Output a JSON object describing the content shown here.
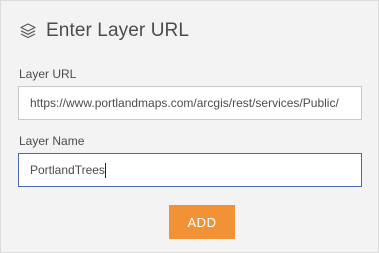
{
  "dialog": {
    "title": "Enter Layer URL",
    "icon": "layers-icon"
  },
  "layer_url": {
    "label": "Layer URL",
    "value": "https://www.portlandmaps.com/arcgis/rest/services/Public/"
  },
  "layer_name": {
    "label": "Layer Name",
    "value": "PortlandTrees"
  },
  "actions": {
    "add_label": "ADD"
  },
  "colors": {
    "accent": "#f09235",
    "focus_border": "#4b6bb0",
    "panel_bg": "#f3f3f3"
  }
}
